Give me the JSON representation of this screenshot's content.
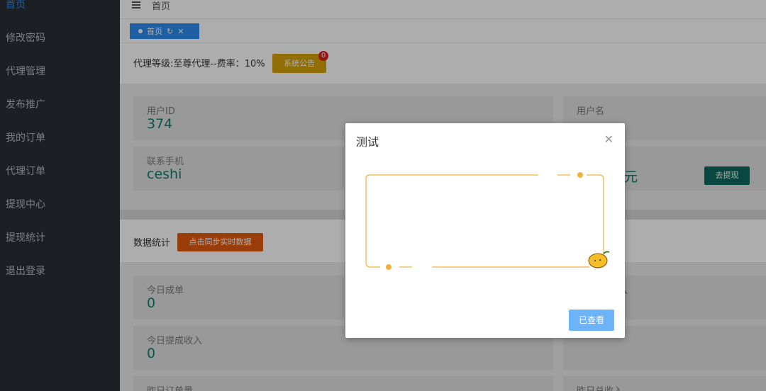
{
  "sidebar": {
    "items": [
      {
        "label": "首页",
        "active": true
      },
      {
        "label": "修改密码"
      },
      {
        "label": "代理管理"
      },
      {
        "label": "发布推广"
      },
      {
        "label": "我的订单"
      },
      {
        "label": "代理订单"
      },
      {
        "label": "提现中心"
      },
      {
        "label": "提现统计"
      },
      {
        "label": "退出登录"
      }
    ]
  },
  "header": {
    "title": "首页",
    "tab_label": "首页"
  },
  "info": {
    "agent_text": "代理等级:至尊代理--费率：10%",
    "notice_button": "系统公告",
    "notice_badge": "0"
  },
  "cards_top": {
    "user_id_label": "用户ID",
    "user_id_value": "374",
    "username_label": "用户名",
    "phone_label": "联系手机",
    "phone_value": "ceshi",
    "balance_suffix": "元",
    "withdraw_button": "去提现"
  },
  "data_stats": {
    "title": "数据统计",
    "sync_button": "点击同步实时数据",
    "today_orders_label": "今日成单",
    "today_orders_value": "0",
    "today_income_label": "今日提成收入",
    "today_income_value": "0",
    "yesterday_orders_label": "昨日订单量",
    "yesterday_total_label": "昨日总收入",
    "right_partial_label": "入"
  },
  "modal": {
    "title": "测试",
    "close_icon": "close-icon",
    "confirm_button": "已查看"
  },
  "colors": {
    "accent": "#2d8cf0",
    "value_text": "#0c7f72",
    "notice": "#d6a40a",
    "sync": "#e35a10",
    "modal_frame": "#f0b33a"
  }
}
